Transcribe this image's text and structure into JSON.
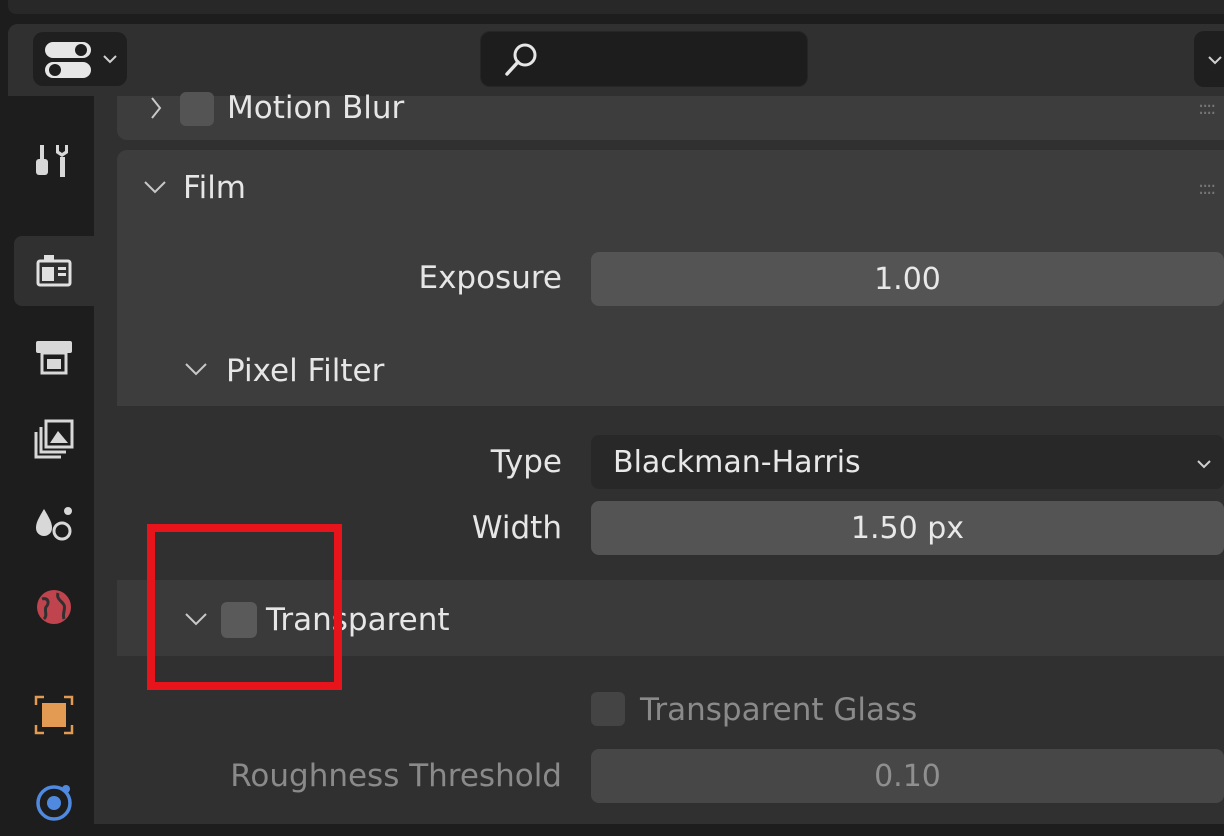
{
  "header": {
    "search_placeholder": "",
    "editor_type_icon": "properties-editor-icon",
    "search_icon": "search-icon"
  },
  "tabs": [
    {
      "name": "tool",
      "icon": "wrench-screwdriver-icon",
      "active": false
    },
    {
      "name": "render",
      "icon": "camera-back-icon",
      "active": true
    },
    {
      "name": "output",
      "icon": "printer-icon",
      "active": false
    },
    {
      "name": "view-layer",
      "icon": "image-stack-icon",
      "active": false
    },
    {
      "name": "scene",
      "icon": "scene-drops-icon",
      "active": false
    },
    {
      "name": "world",
      "icon": "world-globe-icon",
      "active": false
    },
    {
      "name": "object",
      "icon": "object-square-icon",
      "active": false
    },
    {
      "name": "modifiers",
      "icon": "physics-orbit-icon",
      "active": false
    }
  ],
  "motion_blur": {
    "label": "Motion Blur",
    "enabled": false
  },
  "film": {
    "label": "Film",
    "exposure": {
      "label": "Exposure",
      "value": "1.00"
    },
    "pixel_filter": {
      "label": "Pixel Filter",
      "type": {
        "label": "Type",
        "value": "Blackman-Harris"
      },
      "width": {
        "label": "Width",
        "value": "1.50 px"
      }
    },
    "transparent": {
      "label": "Transparent",
      "enabled": false,
      "glass": {
        "label": "Transparent Glass",
        "enabled": false
      },
      "roughness": {
        "label": "Roughness Threshold",
        "value": "0.10"
      }
    }
  },
  "colors": {
    "highlight": "#e8141c",
    "editor_bg": "#303030",
    "panel_bg": "#3d3d3d",
    "field_bg": "#545454"
  }
}
